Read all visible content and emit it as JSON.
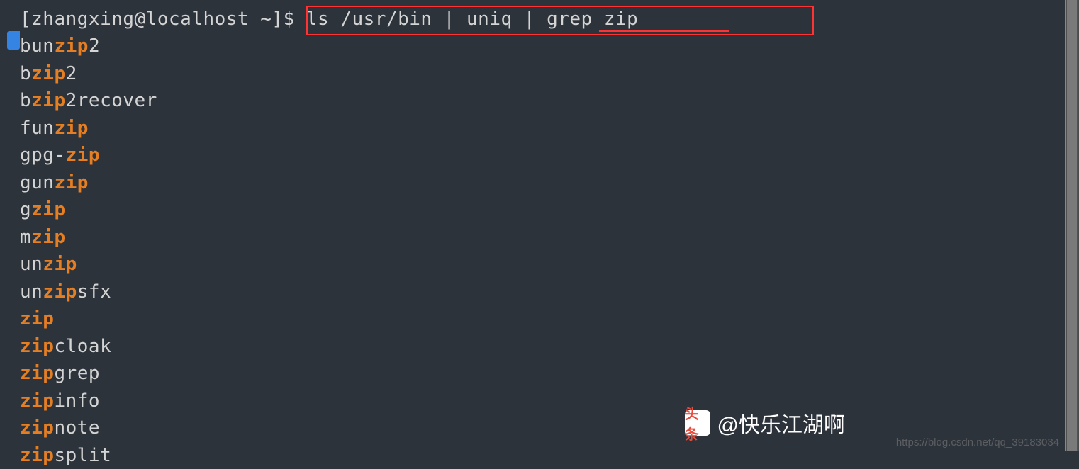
{
  "prompt": {
    "user": "zhangxing",
    "host": "localhost",
    "path": "~",
    "symbol": "$",
    "command": "ls /usr/bin | uniq | grep zip"
  },
  "results": [
    {
      "pre": "bun",
      "match": "zip",
      "post": "2"
    },
    {
      "pre": "b",
      "match": "zip",
      "post": "2"
    },
    {
      "pre": "b",
      "match": "zip",
      "post": "2recover"
    },
    {
      "pre": "fun",
      "match": "zip",
      "post": ""
    },
    {
      "pre": "gpg-",
      "match": "zip",
      "post": ""
    },
    {
      "pre": "gun",
      "match": "zip",
      "post": ""
    },
    {
      "pre": "g",
      "match": "zip",
      "post": ""
    },
    {
      "pre": "m",
      "match": "zip",
      "post": ""
    },
    {
      "pre": "un",
      "match": "zip",
      "post": ""
    },
    {
      "pre": "un",
      "match": "zip",
      "post": "sfx"
    },
    {
      "pre": "",
      "match": "zip",
      "post": ""
    },
    {
      "pre": "",
      "match": "zip",
      "post": "cloak"
    },
    {
      "pre": "",
      "match": "zip",
      "post": "grep"
    },
    {
      "pre": "",
      "match": "zip",
      "post": "info"
    },
    {
      "pre": "",
      "match": "zip",
      "post": "note"
    },
    {
      "pre": "",
      "match": "zip",
      "post": "split"
    }
  ],
  "watermark": {
    "logo_label": "头条",
    "logo_text": "@快乐江湖啊",
    "url": "https://blog.csdn.net/qq_39183034"
  }
}
